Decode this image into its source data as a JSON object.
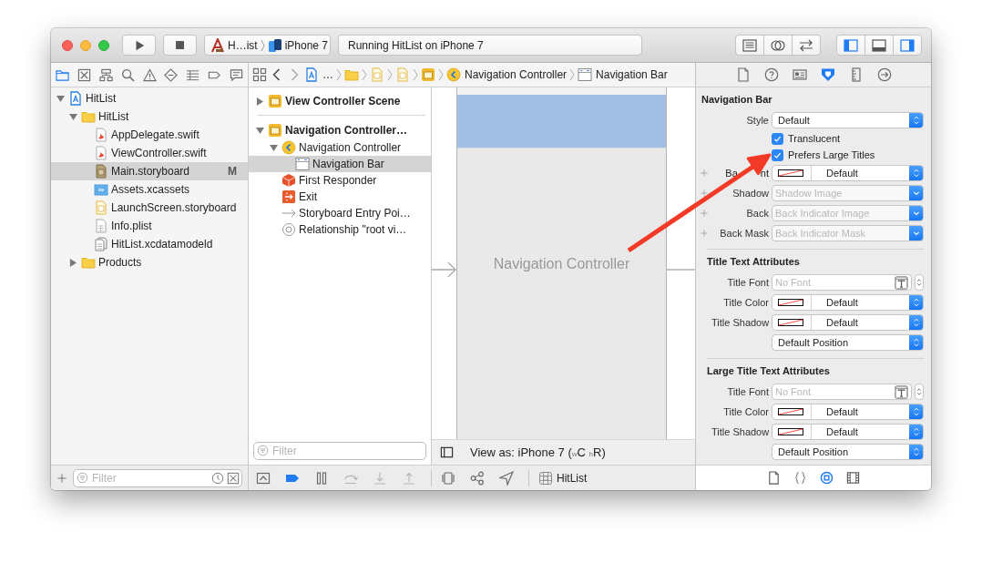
{
  "toolbar": {
    "scheme": {
      "target": "H…ist",
      "device": "iPhone 7"
    },
    "activity": "Running HitList on iPhone 7",
    "editor_modes": [
      {
        "kind": "lines"
      },
      {
        "kind": "circles"
      },
      {
        "kind": "arrows"
      }
    ],
    "panels": [
      {
        "kind": "panel-left",
        "selected": true
      },
      {
        "kind": "panel-bottom",
        "selected": false
      },
      {
        "kind": "panel-right",
        "selected": true
      }
    ]
  },
  "navigator": {
    "tabs": [
      {
        "kind": "folder-tab",
        "selected": true
      },
      {
        "kind": "xbox",
        "selected": false
      },
      {
        "kind": "hierarchy",
        "selected": false
      },
      {
        "kind": "search",
        "selected": false
      },
      {
        "kind": "warning",
        "selected": false
      },
      {
        "kind": "diamond",
        "selected": false
      },
      {
        "kind": "list",
        "selected": false
      },
      {
        "kind": "tag",
        "selected": false
      },
      {
        "kind": "bubble",
        "selected": false
      }
    ],
    "tree": [
      {
        "kind": "project",
        "label": "HitList",
        "expanded": true,
        "selected": false,
        "children": [
          {
            "kind": "folder",
            "label": "HitList",
            "expanded": true,
            "selected": false,
            "children": [
              {
                "kind": "swift",
                "label": "AppDelegate.swift",
                "selected": false
              },
              {
                "kind": "swift",
                "label": "ViewController.swift",
                "selected": false
              },
              {
                "kind": "storyboard",
                "label": "Main.storyboard",
                "selected": true,
                "badge": "M"
              },
              {
                "kind": "assets",
                "label": "Assets.xcassets",
                "selected": false
              },
              {
                "kind": "launch",
                "label": "LaunchScreen.storyboard",
                "selected": false
              },
              {
                "kind": "plist",
                "label": "Info.plist",
                "selected": false
              },
              {
                "kind": "datamodel",
                "label": "HitList.xcdatamodeld",
                "selected": false
              }
            ]
          },
          {
            "kind": "folder",
            "label": "Products",
            "expanded": false,
            "selected": false
          }
        ]
      }
    ],
    "filter": {
      "placeholder": "Filter"
    }
  },
  "jump_bar": {
    "crumbs": [
      {
        "kind": "project",
        "label": "…"
      },
      {
        "kind": "folder"
      },
      {
        "kind": "launch"
      },
      {
        "kind": "launch"
      },
      {
        "kind": "scene"
      },
      {
        "kind": "navcontroller",
        "label": "Navigation Controller"
      },
      {
        "kind": "navbar",
        "label": "Navigation Bar"
      }
    ]
  },
  "outline": {
    "scenes": [
      {
        "kind": "scene",
        "label": "View Controller Scene",
        "expanded": false,
        "selected": false
      },
      {
        "kind": "scene",
        "label": "Navigation Controller…",
        "expanded": true,
        "selected": false,
        "children": [
          {
            "kind": "navcontroller",
            "label": "Navigation Controller",
            "expanded": true,
            "selected": false,
            "children": [
              {
                "kind": "navbar",
                "label": "Navigation Bar",
                "selected": true
              }
            ]
          },
          {
            "kind": "responder",
            "label": "First Responder",
            "selected": false
          },
          {
            "kind": "exit",
            "label": "Exit",
            "selected": false
          },
          {
            "kind": "entry",
            "label": "Storyboard Entry Poi…",
            "selected": false
          },
          {
            "kind": "relationship",
            "label": "Relationship \"root vi…",
            "selected": false
          }
        ]
      }
    ],
    "filter": {
      "placeholder": "Filter"
    }
  },
  "canvas": {
    "title": "Navigation Controller",
    "view_as": "View as: iPhone 7 ($_{w}$C $_{h}$R)"
  },
  "debug_bar": {
    "buttons": [
      {
        "kind": "hide",
        "on": false,
        "disabled": false
      },
      {
        "kind": "tag",
        "on": true,
        "disabled": false
      },
      {
        "kind": "pause",
        "on": false,
        "disabled": false
      },
      {
        "kind": "stepover",
        "on": false,
        "disabled": true
      },
      {
        "kind": "stepin",
        "on": false,
        "disabled": true
      },
      {
        "kind": "stepout",
        "on": false,
        "disabled": true
      },
      {
        "kind": "viewdebug",
        "on": false,
        "disabled": false
      },
      {
        "kind": "graph",
        "on": false,
        "disabled": false
      },
      {
        "kind": "location",
        "on": false,
        "disabled": false
      }
    ],
    "target": "HitList"
  },
  "inspector": {
    "tabs": [
      {
        "kind": "doc",
        "selected": false
      },
      {
        "kind": "help",
        "selected": false
      },
      {
        "kind": "idcard",
        "selected": false
      },
      {
        "kind": "attributes",
        "selected": true
      },
      {
        "kind": "ruler",
        "selected": false
      },
      {
        "kind": "connections",
        "selected": false
      }
    ],
    "sections": [
      {
        "title": "Navigation Bar",
        "rows": [
          {
            "kind": "popup",
            "label": "Style",
            "value": "Default",
            "plus": false
          },
          {
            "kind": "checkbox",
            "label": "Translucent",
            "checked": true
          },
          {
            "kind": "checkbox",
            "label": "Prefers Large Titles",
            "checked": true
          },
          {
            "kind": "color",
            "label": "Ba",
            "label_tail": "nt",
            "value": "Default",
            "plus": true
          },
          {
            "kind": "image",
            "label": "Shadow",
            "placeholder": "Shadow Image",
            "plus": true
          },
          {
            "kind": "image",
            "label": "Back",
            "placeholder": "Back Indicator Image",
            "plus": true
          },
          {
            "kind": "image",
            "label": "Back Mask",
            "placeholder": "Back Indicator Mask",
            "plus": true
          }
        ]
      },
      {
        "title": "Title Text Attributes",
        "rows": [
          {
            "kind": "font",
            "label": "Title Font",
            "placeholder": "No Font",
            "plus": false
          },
          {
            "kind": "color",
            "label": "Title Color",
            "value": "Default",
            "plus": false
          },
          {
            "kind": "color",
            "label": "Title Shadow",
            "value": "Default",
            "plus": false
          },
          {
            "kind": "popup",
            "value": "Default Position",
            "plus": false
          }
        ]
      },
      {
        "title": "Large Title Text Attributes",
        "rows": [
          {
            "kind": "font",
            "label": "Title Font",
            "placeholder": "No Font",
            "plus": false
          },
          {
            "kind": "color",
            "label": "Title Color",
            "value": "Default",
            "plus": false
          },
          {
            "kind": "color",
            "label": "Title Shadow",
            "value": "Default",
            "plus": false
          },
          {
            "kind": "popup",
            "value": "Default Position",
            "plus": false
          }
        ]
      }
    ],
    "library_tabs": [
      {
        "kind": "doc",
        "selected": false
      },
      {
        "kind": "braces",
        "selected": false
      },
      {
        "kind": "target",
        "selected": true
      },
      {
        "kind": "film",
        "selected": false
      }
    ]
  }
}
